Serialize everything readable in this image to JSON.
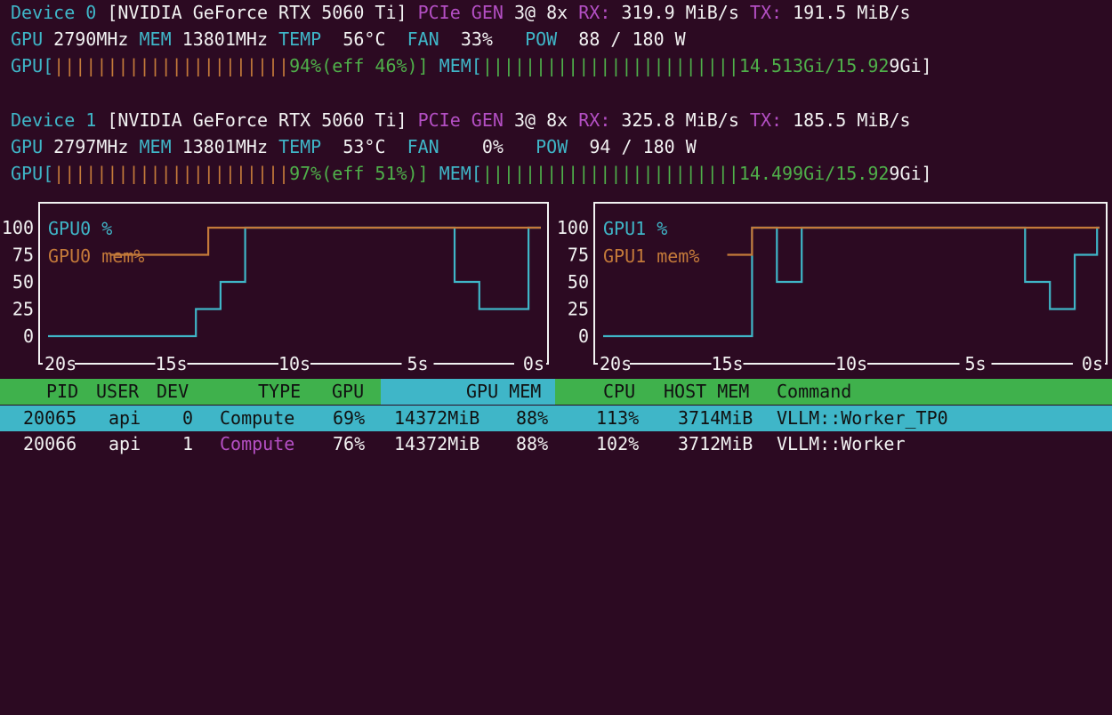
{
  "devices": [
    {
      "label": "Device 0",
      "name": "[NVIDIA GeForce RTX 5060 Ti]",
      "pcie_label": "PCIe",
      "gen_label": "GEN",
      "gen_value": "3@ 8x",
      "rx_label": "RX:",
      "rx_value": "319.9 MiB/s",
      "tx_label": "TX:",
      "tx_value": "191.5 MiB/s",
      "gpu_label": "GPU",
      "gpu_clock": "2790MHz",
      "mem_label": "MEM",
      "mem_clock": "13801MHz",
      "temp_label": "TEMP",
      "temp_value": "56°C",
      "fan_label": "FAN",
      "fan_value": "33%",
      "pow_label": "POW",
      "pow_value": "88 / 180 W",
      "util_label": "GPU[",
      "util_bar": "||||||||||||||||||||||",
      "util_value": "94%(eff 46%)]",
      "mem_bar_label": "MEM[",
      "mem_bar": "||||||||||||||||||||||||",
      "mem_value": "14.513Gi/15.92",
      "mem_value_tail": "9Gi]",
      "gpu_util_percent": 94,
      "mem_used_gib": 14.513,
      "mem_total_gib": 15.929
    },
    {
      "label": "Device 1",
      "name": "[NVIDIA GeForce RTX 5060 Ti]",
      "pcie_label": "PCIe",
      "gen_label": "GEN",
      "gen_value": "3@ 8x",
      "rx_label": "RX:",
      "rx_value": "325.8 MiB/s",
      "tx_label": "TX:",
      "tx_value": "185.5 MiB/s",
      "gpu_label": "GPU",
      "gpu_clock": "2797MHz",
      "mem_label": "MEM",
      "mem_clock": "13801MHz",
      "temp_label": "TEMP",
      "temp_value": "53°C",
      "fan_label": "FAN",
      "fan_value": "0%",
      "pow_label": "POW",
      "pow_value": "94 / 180 W",
      "util_label": "GPU[",
      "util_bar": "||||||||||||||||||||||",
      "util_value": "97%(eff 51%)]",
      "mem_bar_label": "MEM[",
      "mem_bar": "||||||||||||||||||||||||",
      "mem_value": "14.499Gi/15.92",
      "mem_value_tail": "9Gi]",
      "gpu_util_percent": 97,
      "mem_used_gib": 14.499,
      "mem_total_gib": 15.929
    }
  ],
  "chart_data": [
    {
      "type": "line",
      "legend": [
        "GPU0 %",
        "GPU0 mem%"
      ],
      "yticks": [
        "100",
        "75",
        "50",
        "25",
        "0"
      ],
      "xticks": [
        "20s",
        "15s",
        "10s",
        "5s",
        "0s"
      ],
      "ylim": [
        0,
        100
      ],
      "xlim": [
        -20,
        0
      ],
      "series": [
        {
          "name": "GPU0 %",
          "color": "#3fb6c8",
          "points": [
            [
              -20,
              0
            ],
            [
              -14,
              0
            ],
            [
              -14,
              25
            ],
            [
              -13,
              25
            ],
            [
              -13,
              50
            ],
            [
              -12,
              50
            ],
            [
              -12,
              100
            ],
            [
              -3.5,
              100
            ],
            [
              -3.5,
              50
            ],
            [
              -2.5,
              50
            ],
            [
              -2.5,
              25
            ],
            [
              -0.5,
              25
            ],
            [
              -0.5,
              100
            ],
            [
              0,
              100
            ]
          ]
        },
        {
          "name": "GPU0 mem%",
          "color": "#c47a3a",
          "points": [
            [
              -17.5,
              75
            ],
            [
              -13.5,
              75
            ],
            [
              -13.5,
              100
            ],
            [
              0,
              100
            ]
          ]
        }
      ]
    },
    {
      "type": "line",
      "legend": [
        "GPU1 %",
        "GPU1 mem%"
      ],
      "yticks": [
        "100",
        "75",
        "50",
        "25",
        "0"
      ],
      "xticks": [
        "20s",
        "15s",
        "10s",
        "5s",
        "0s"
      ],
      "ylim": [
        0,
        100
      ],
      "xlim": [
        -20,
        0
      ],
      "series": [
        {
          "name": "GPU1 %",
          "color": "#3fb6c8",
          "points": [
            [
              -20,
              0
            ],
            [
              -14,
              0
            ],
            [
              -14,
              100
            ],
            [
              -13,
              100
            ],
            [
              -13,
              50
            ],
            [
              -12,
              50
            ],
            [
              -12,
              100
            ],
            [
              -3,
              100
            ],
            [
              -3,
              50
            ],
            [
              -2,
              50
            ],
            [
              -2,
              25
            ],
            [
              -1,
              25
            ],
            [
              -1,
              75
            ],
            [
              -0.1,
              75
            ],
            [
              -0.1,
              100
            ],
            [
              0,
              100
            ]
          ]
        },
        {
          "name": "GPU1 mem%",
          "color": "#c47a3a",
          "points": [
            [
              -15,
              75
            ],
            [
              -14,
              75
            ],
            [
              -14,
              100
            ],
            [
              0,
              100
            ]
          ]
        }
      ]
    }
  ],
  "table": {
    "headers": {
      "pid": "PID",
      "user": "USER",
      "dev": "DEV",
      "type": "TYPE",
      "gpu": "GPU",
      "gpu_mem": "GPU MEM",
      "cpu": "CPU",
      "host_mem": "HOST MEM",
      "command": "Command"
    },
    "rows": [
      {
        "pid": "20065",
        "user": "api",
        "dev": "0",
        "type": "Compute",
        "gpu": "69%",
        "gpu_mem": "14372MiB",
        "gpu_mem_pct": "88%",
        "cpu": "113%",
        "host_mem": "3714MiB",
        "command": "VLLM::Worker_TP0"
      },
      {
        "pid": "20066",
        "user": "api",
        "dev": "1",
        "type": "Compute",
        "gpu": "76%",
        "gpu_mem": "14372MiB",
        "gpu_mem_pct": "88%",
        "cpu": "102%",
        "host_mem": "3712MiB",
        "command": "VLLM::Worker"
      }
    ]
  },
  "colors": {
    "background": "#2c0a22",
    "cyan": "#3fb6c8",
    "purple": "#b44fc4",
    "green": "#4fb04a",
    "orange": "#c47a3a",
    "header_green": "#3fb14c"
  }
}
